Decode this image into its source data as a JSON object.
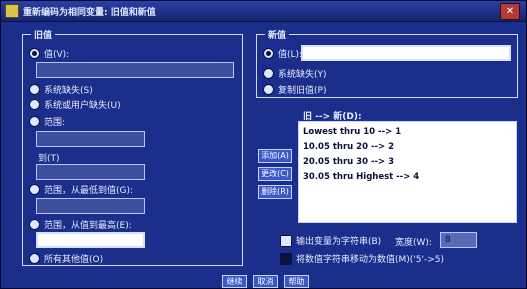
{
  "window": {
    "title": "重新编码为相同变量: 旧值和新值",
    "close_glyph": "✕"
  },
  "old_value": {
    "group_title": "旧值",
    "options": [
      {
        "label": "值(V):",
        "selected": true
      },
      {
        "label": "系统缺失(S)",
        "selected": false
      },
      {
        "label": "系统或用户缺失(U)",
        "selected": false
      },
      {
        "label": "范围:",
        "selected": false
      },
      {
        "label": "范围，从最低到值(G):",
        "selected": false
      },
      {
        "label": "范围，从值到最高(E):",
        "selected": false
      },
      {
        "label": "所有其他值(O)",
        "selected": false
      }
    ],
    "to_label": "到(T)",
    "value_input": "",
    "range_from": "",
    "range_to": "",
    "lowest_through": "",
    "through_highest": ""
  },
  "new_value": {
    "group_title": "新值",
    "options": [
      {
        "label": "值(L):",
        "selected": true
      },
      {
        "label": "系统缺失(Y)",
        "selected": false
      },
      {
        "label": "复制旧值(P)",
        "selected": false
      }
    ],
    "value_input": ""
  },
  "mapping": {
    "label": "旧 --> 新(D):",
    "items": [
      "Lowest thru 10 --> 1",
      "10.05 thru 20 --> 2",
      "20.05 thru 30 --> 3",
      "30.05 thru Highest --> 4"
    ],
    "add_label": "添加(A)",
    "change_label": "更改(C)",
    "remove_label": "删除(R)"
  },
  "options": {
    "output_string_label": "输出变量为字符串(B)",
    "width_label": "宽度(W):",
    "width_value": "8",
    "output_string_checked": false,
    "numeric_convert_label": "将数值字符串移动为数值(M)('5'->5)",
    "numeric_convert_checked": false
  },
  "footer": {
    "continue_label": "继续",
    "cancel_label": "取消",
    "help_label": "帮助"
  }
}
